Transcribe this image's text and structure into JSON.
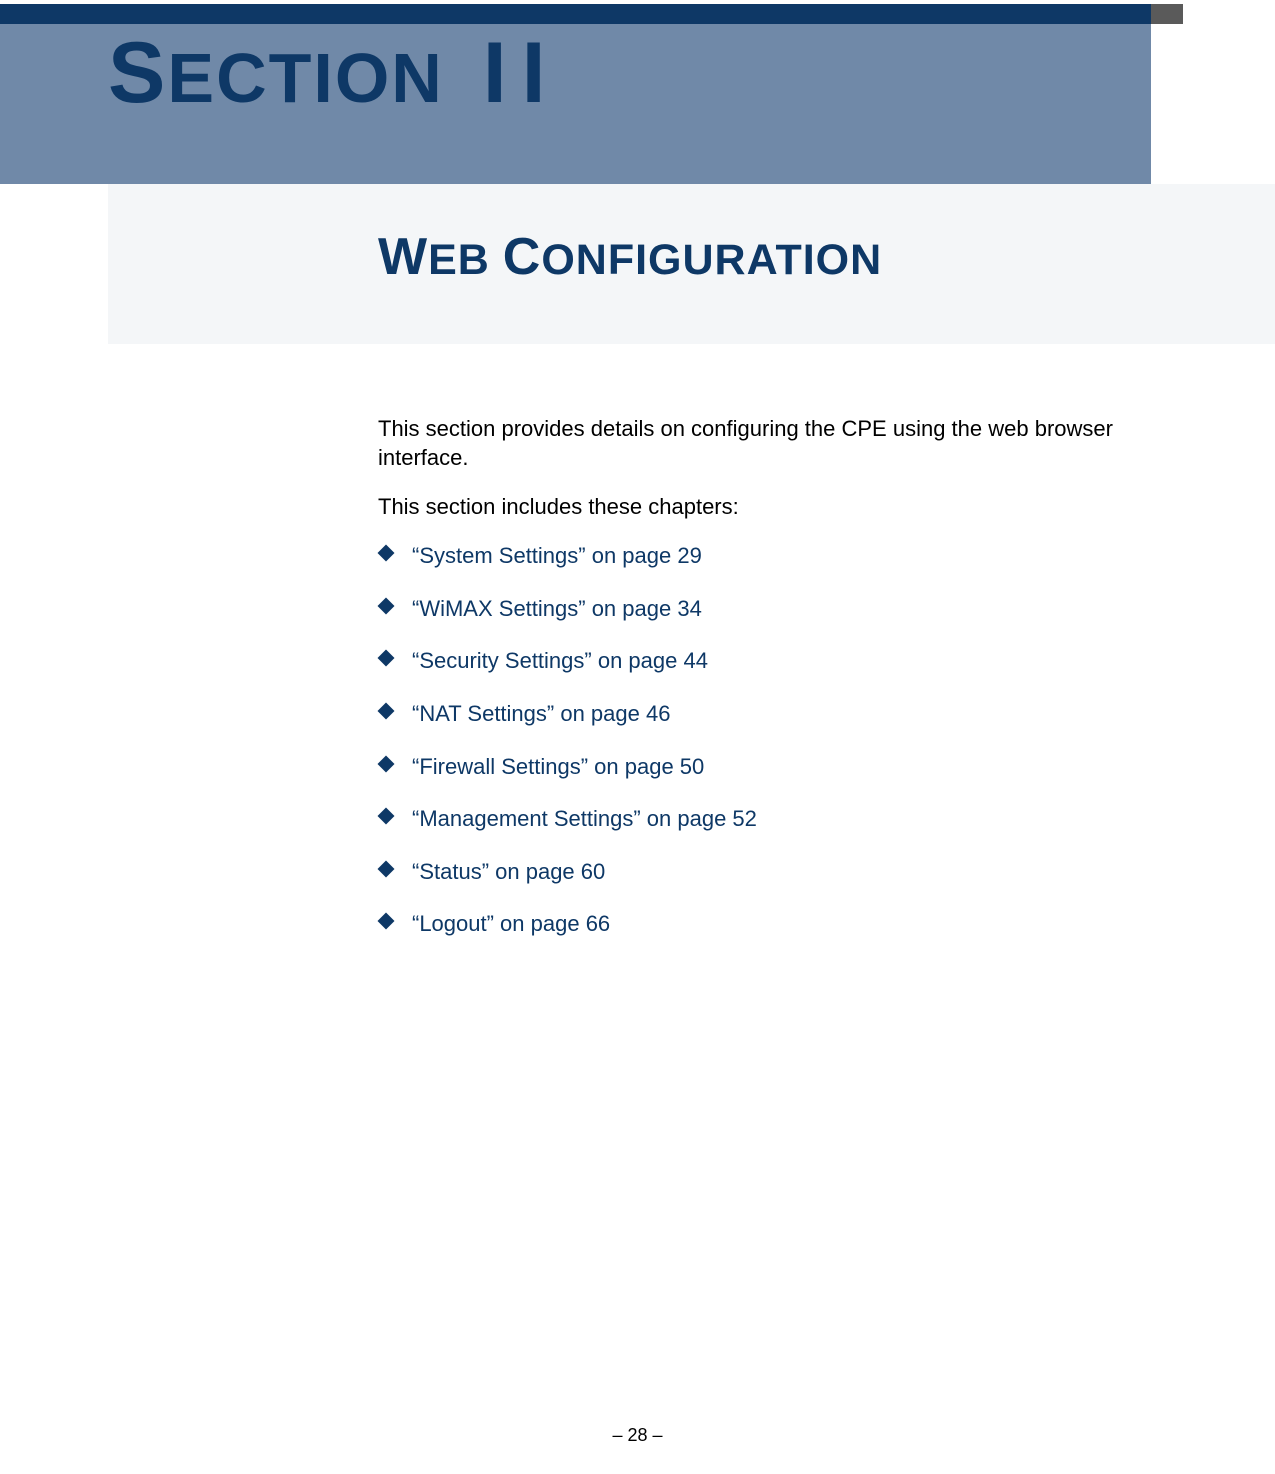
{
  "section_label_prefix": "S",
  "section_label_body": "ECTION",
  "section_label_space": " I",
  "section_label_suffix": "I",
  "header_title_w": "W",
  "header_title_eb": "EB ",
  "header_title_c": "C",
  "header_title_onfig": "ONFIGURATION",
  "intro": "This section provides details on configuring the CPE using the web browser interface.",
  "chapters_intro": "This section includes these chapters:",
  "chapters": [
    {
      "label": "“System Settings” on page 29"
    },
    {
      "label": "“WiMAX Settings” on page 34"
    },
    {
      "label": "“Security Settings” on page 44"
    },
    {
      "label": "“NAT Settings” on page 46"
    },
    {
      "label": "“Firewall Settings” on page 50"
    },
    {
      "label": "“Management Settings” on page 52"
    },
    {
      "label": "“Status” on page 60"
    },
    {
      "label": "“Logout” on page 66"
    }
  ],
  "footer": "–  28  –"
}
